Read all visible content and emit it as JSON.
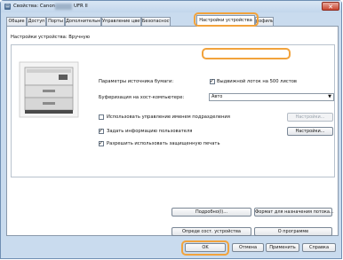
{
  "window": {
    "title": "Свойства: Canon",
    "title_suffix": "UFR II",
    "close_glyph": "✕"
  },
  "tabs": [
    {
      "label": "Общие"
    },
    {
      "label": "Доступ"
    },
    {
      "label": "Порты"
    },
    {
      "label": "Дополнительно"
    },
    {
      "label": "Управление цветом"
    },
    {
      "label": "Безопасност"
    },
    {
      "label": "Настройки устройства",
      "active": true
    },
    {
      "label": "рофиль"
    }
  ],
  "panel": {
    "settings_label": "Настройки устройства: Вручную",
    "paper_source_label": "Параметры источника бумаги:",
    "paper_source_option": "Выдвижной лоток на 500 листов",
    "paper_source_checked": true,
    "spooling_label": "Буферизация на хост-компьютере:",
    "spooling_value": "Авто",
    "dept_mgmt_label": "Использовать управление именем подразделения",
    "dept_mgmt_checked": false,
    "dept_settings_button": "Настройки...",
    "user_info_label": "Задать информацию пользователя",
    "user_info_checked": true,
    "user_settings_button": "Настройки...",
    "secure_print_label": "Разрешить использовать защищенную печать",
    "secure_print_checked": true,
    "details_button": "Подробно(I)...",
    "dest_format_button": "Формат для назначения потока...",
    "detect_state_button": "Опреде сост. устройства",
    "about_button": "О программе"
  },
  "footer": {
    "ok": "OK",
    "cancel": "Отмена",
    "apply": "Применить",
    "help": "Справка"
  },
  "colors": {
    "highlight": "#f2a33c",
    "chrome": "#c9dbee"
  }
}
